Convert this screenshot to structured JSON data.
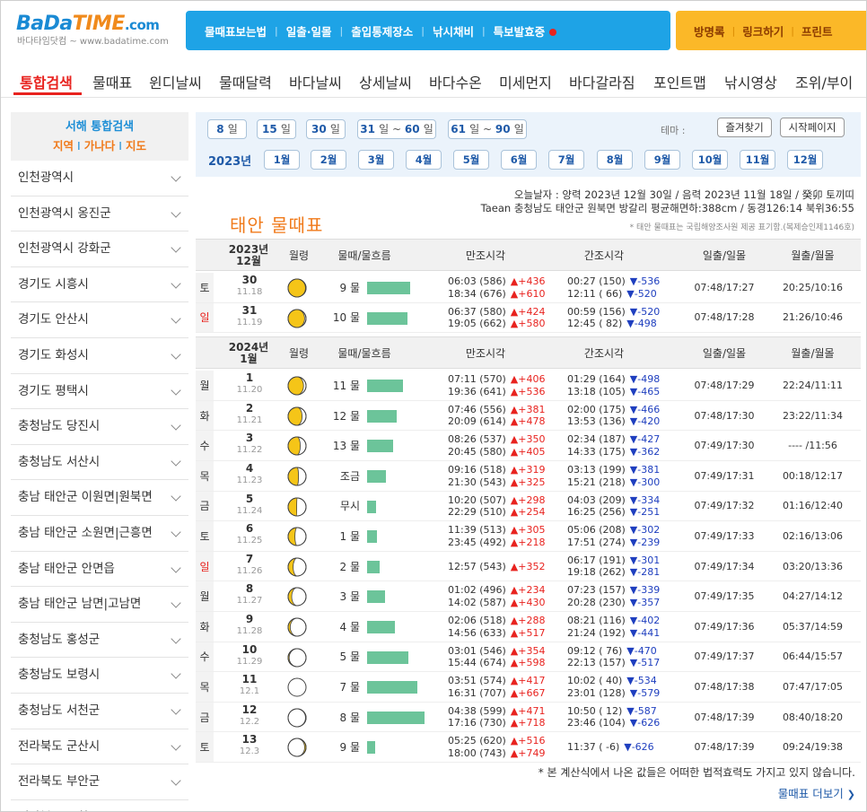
{
  "logo": {
    "word1": "BaDa",
    "word2": "TIME",
    "suffix": ".com",
    "tagline": "바다타임닷컴 ~ www.badatime.com"
  },
  "topnav": [
    "물때표보는법",
    "일출·일몰",
    "출입통제장소",
    "낚시채비",
    "특보발효중"
  ],
  "toplinks": [
    "방명록",
    "링크하기",
    "프린트"
  ],
  "maintabs": [
    "통합검색",
    "물때표",
    "윈디날씨",
    "물때달력",
    "바다날씨",
    "상세날씨",
    "바다수온",
    "미세먼지",
    "바다갈라짐",
    "포인트맵",
    "낚시영상",
    "조위/부이"
  ],
  "sidebar": {
    "title": "서해 통합검색",
    "links": [
      "지역",
      "가나다",
      "지도"
    ],
    "regions": [
      "인천광역시",
      "인천광역시 옹진군",
      "인천광역시 강화군",
      "경기도 시흥시",
      "경기도 안산시",
      "경기도 화성시",
      "경기도 평택시",
      "충청남도 당진시",
      "충청남도 서산시",
      "충남 태안군 이원면|원북면",
      "충남 태안군 소원면|근흥면",
      "충남 태안군 안면읍",
      "충남 태안군 남면|고남면",
      "충청남도 홍성군",
      "충청남도 보령시",
      "충청남도 서천군",
      "전라북도 군산시",
      "전라북도 부안군",
      "전라북도 고창군"
    ]
  },
  "datebar": {
    "ranges": [
      {
        "n": "8",
        "u": "일"
      },
      {
        "n": "15",
        "u": "일"
      },
      {
        "n": "30",
        "u": "일"
      },
      {
        "n": "31",
        "u": "일 ~ ",
        "n2": "60",
        "u2": "일"
      },
      {
        "n": "61",
        "u": "일 ~ ",
        "n2": "90",
        "u2": "일"
      }
    ],
    "year": "2023년",
    "months": [
      "1월",
      "2월",
      "3월",
      "4월",
      "5월",
      "6월",
      "7월",
      "8월",
      "9월",
      "10월",
      "11월",
      "12월"
    ],
    "theme": "테마 :",
    "favorites": "즐겨찾기",
    "homepage": "시작페이지"
  },
  "info": {
    "today": "오늘날자 : 양력 2023년 12월 30일 / 음력 2023년 11월 18일 / 癸卯 토끼띠",
    "location": "Taean 충청남도 태안군 원북면 방갈리 평균해면하:388cm / 동경126:14 북위36:55",
    "title": "태안 물때표",
    "credit": "* 태안 물때표는 국립해양조사원 제공 표기함.(복제승인제1146호)"
  },
  "table": {
    "headers": [
      "월령",
      "물때/물흐름",
      "만조시각",
      "간조시각",
      "일출/일몰",
      "월출/월몰"
    ],
    "sections": [
      {
        "year": "2023년",
        "month": "12월",
        "rows": [
          {
            "wd": "토",
            "day": "30",
            "lunar": "11.18",
            "moon": 0.97,
            "mul": "9 물",
            "flow": 0.75,
            "high": [
              {
                "t": "06:03 (586)",
                "d": "▲+436"
              },
              {
                "t": "18:34 (676)",
                "d": "▲+610"
              }
            ],
            "low": [
              {
                "t": "00:27 (150)",
                "d": "▼-536"
              },
              {
                "t": "12:11 ( 66)",
                "d": "▼-520"
              }
            ],
            "sun": "07:48/17:27",
            "moonrs": "20:25/10:16"
          },
          {
            "wd": "일",
            "day": "31",
            "lunar": "11.19",
            "moon": 0.92,
            "mul": "10 물",
            "flow": 0.7,
            "high": [
              {
                "t": "06:37 (580)",
                "d": "▲+424"
              },
              {
                "t": "19:05 (662)",
                "d": "▲+580"
              }
            ],
            "low": [
              {
                "t": "00:59 (156)",
                "d": "▼-520"
              },
              {
                "t": "12:45 ( 82)",
                "d": "▼-498"
              }
            ],
            "sun": "07:48/17:28",
            "moonrs": "21:26/10:46"
          }
        ]
      },
      {
        "year": "2024년",
        "month": "1월",
        "rows": [
          {
            "wd": "월",
            "day": "1",
            "lunar": "11.20",
            "moon": 0.86,
            "mul": "11 물",
            "flow": 0.62,
            "high": [
              {
                "t": "07:11 (570)",
                "d": "▲+406"
              },
              {
                "t": "19:36 (641)",
                "d": "▲+536"
              }
            ],
            "low": [
              {
                "t": "01:29 (164)",
                "d": "▼-498"
              },
              {
                "t": "13:18 (105)",
                "d": "▼-465"
              }
            ],
            "sun": "07:48/17:29",
            "moonrs": "22:24/11:11"
          },
          {
            "wd": "화",
            "day": "2",
            "lunar": "11.21",
            "moon": 0.78,
            "mul": "12 물",
            "flow": 0.52,
            "high": [
              {
                "t": "07:46 (556)",
                "d": "▲+381"
              },
              {
                "t": "20:09 (614)",
                "d": "▲+478"
              }
            ],
            "low": [
              {
                "t": "02:00 (175)",
                "d": "▼-466"
              },
              {
                "t": "13:53 (136)",
                "d": "▼-420"
              }
            ],
            "sun": "07:48/17:30",
            "moonrs": "23:22/11:34"
          },
          {
            "wd": "수",
            "day": "3",
            "lunar": "11.22",
            "moon": 0.68,
            "mul": "13 물",
            "flow": 0.45,
            "high": [
              {
                "t": "08:26 (537)",
                "d": "▲+350"
              },
              {
                "t": "20:45 (580)",
                "d": "▲+405"
              }
            ],
            "low": [
              {
                "t": "02:34 (187)",
                "d": "▼-427"
              },
              {
                "t": "14:33 (175)",
                "d": "▼-362"
              }
            ],
            "sun": "07:49/17:30",
            "moonrs": "---- /11:56"
          },
          {
            "wd": "목",
            "day": "4",
            "lunar": "11.23",
            "moon": 0.58,
            "mul": "조금",
            "flow": 0.33,
            "high": [
              {
                "t": "09:16 (518)",
                "d": "▲+319"
              },
              {
                "t": "21:30 (543)",
                "d": "▲+325"
              }
            ],
            "low": [
              {
                "t": "03:13 (199)",
                "d": "▼-381"
              },
              {
                "t": "15:21 (218)",
                "d": "▼-300"
              }
            ],
            "sun": "07:49/17:31",
            "moonrs": "00:18/12:17"
          },
          {
            "wd": "금",
            "day": "5",
            "lunar": "11.24",
            "moon": 0.48,
            "mul": "무시",
            "flow": 0.16,
            "high": [
              {
                "t": "10:20 (507)",
                "d": "▲+298"
              },
              {
                "t": "22:29 (510)",
                "d": "▲+254"
              }
            ],
            "low": [
              {
                "t": "04:03 (209)",
                "d": "▼-334"
              },
              {
                "t": "16:25 (256)",
                "d": "▼-251"
              }
            ],
            "sun": "07:49/17:32",
            "moonrs": "01:16/12:40"
          },
          {
            "wd": "토",
            "day": "6",
            "lunar": "11.25",
            "moon": 0.38,
            "mul": "1 물",
            "flow": 0.17,
            "high": [
              {
                "t": "11:39 (513)",
                "d": "▲+305"
              },
              {
                "t": "23:45 (492)",
                "d": "▲+218"
              }
            ],
            "low": [
              {
                "t": "05:06 (208)",
                "d": "▼-302"
              },
              {
                "t": "17:51 (274)",
                "d": "▼-239"
              }
            ],
            "sun": "07:49/17:33",
            "moonrs": "02:16/13:06"
          },
          {
            "wd": "일",
            "day": "7",
            "lunar": "11.26",
            "moon": 0.28,
            "mul": "2 물",
            "flow": 0.22,
            "high": [
              {
                "t": "12:57 (543)",
                "d": "▲+352"
              }
            ],
            "low": [
              {
                "t": "06:17 (191)",
                "d": "▼-301"
              },
              {
                "t": "19:18 (262)",
                "d": "▼-281"
              }
            ],
            "sun": "07:49/17:34",
            "moonrs": "03:20/13:36"
          },
          {
            "wd": "월",
            "day": "8",
            "lunar": "11.27",
            "moon": 0.2,
            "mul": "3 물",
            "flow": 0.32,
            "high": [
              {
                "t": "01:02 (496)",
                "d": "▲+234"
              },
              {
                "t": "14:02 (587)",
                "d": "▲+430"
              }
            ],
            "low": [
              {
                "t": "07:23 (157)",
                "d": "▼-339"
              },
              {
                "t": "20:28 (230)",
                "d": "▼-357"
              }
            ],
            "sun": "07:49/17:35",
            "moonrs": "04:27/14:12"
          },
          {
            "wd": "화",
            "day": "9",
            "lunar": "11.28",
            "moon": 0.12,
            "mul": "4 물",
            "flow": 0.48,
            "high": [
              {
                "t": "02:06 (518)",
                "d": "▲+288"
              },
              {
                "t": "14:56 (633)",
                "d": "▲+517"
              }
            ],
            "low": [
              {
                "t": "08:21 (116)",
                "d": "▼-402"
              },
              {
                "t": "21:24 (192)",
                "d": "▼-441"
              }
            ],
            "sun": "07:49/17:36",
            "moonrs": "05:37/14:59"
          },
          {
            "wd": "수",
            "day": "10",
            "lunar": "11.29",
            "moon": 0.06,
            "mul": "5 물",
            "flow": 0.72,
            "high": [
              {
                "t": "03:01 (546)",
                "d": "▲+354"
              },
              {
                "t": "15:44 (674)",
                "d": "▲+598"
              }
            ],
            "low": [
              {
                "t": "09:12 ( 76)",
                "d": "▼-470"
              },
              {
                "t": "22:13 (157)",
                "d": "▼-517"
              }
            ],
            "sun": "07:49/17:37",
            "moonrs": "06:44/15:57"
          },
          {
            "wd": "목",
            "day": "11",
            "lunar": "12.1",
            "moon": 0.0,
            "mul": "7 물",
            "flow": 0.87,
            "high": [
              {
                "t": "03:51 (574)",
                "d": "▲+417"
              },
              {
                "t": "16:31 (707)",
                "d": "▲+667"
              }
            ],
            "low": [
              {
                "t": "10:02 ( 40)",
                "d": "▼-534"
              },
              {
                "t": "23:01 (128)",
                "d": "▼-579"
              }
            ],
            "sun": "07:48/17:38",
            "moonrs": "07:47/17:05"
          },
          {
            "wd": "금",
            "day": "12",
            "lunar": "12.2",
            "moon": 0.03,
            "mul": "8 물",
            "flow": 1.0,
            "high": [
              {
                "t": "04:38 (599)",
                "d": "▲+471"
              },
              {
                "t": "17:16 (730)",
                "d": "▲+718"
              }
            ],
            "low": [
              {
                "t": "10:50 ( 12)",
                "d": "▼-587"
              },
              {
                "t": "23:46 (104)",
                "d": "▼-626"
              }
            ],
            "sun": "07:48/17:39",
            "moonrs": "08:40/18:20"
          },
          {
            "wd": "토",
            "day": "13",
            "lunar": "12.3",
            "moon": 0.08,
            "mul": "9 물",
            "flow": 0.14,
            "high": [
              {
                "t": "05:25 (620)",
                "d": "▲+516"
              },
              {
                "t": "18:00 (743)",
                "d": "▲+749"
              }
            ],
            "low": [
              {
                "t": "11:37 ( -6)",
                "d": "▼-626"
              }
            ],
            "sun": "07:48/17:39",
            "moonrs": "09:24/19:38"
          }
        ]
      }
    ]
  },
  "footer": {
    "disclaimer": "* 본 계산식에서 나온 값들은 어떠한 법적효력도 가지고 있지 않습니다.",
    "more": "물때표 더보기"
  },
  "colors": {
    "accent_blue": "#1ea3e6",
    "accent_orange": "#fbb828",
    "tab_active": "#e8231f",
    "flow_bar": "#6cc49a",
    "moon_yellow": "#f5c518"
  }
}
